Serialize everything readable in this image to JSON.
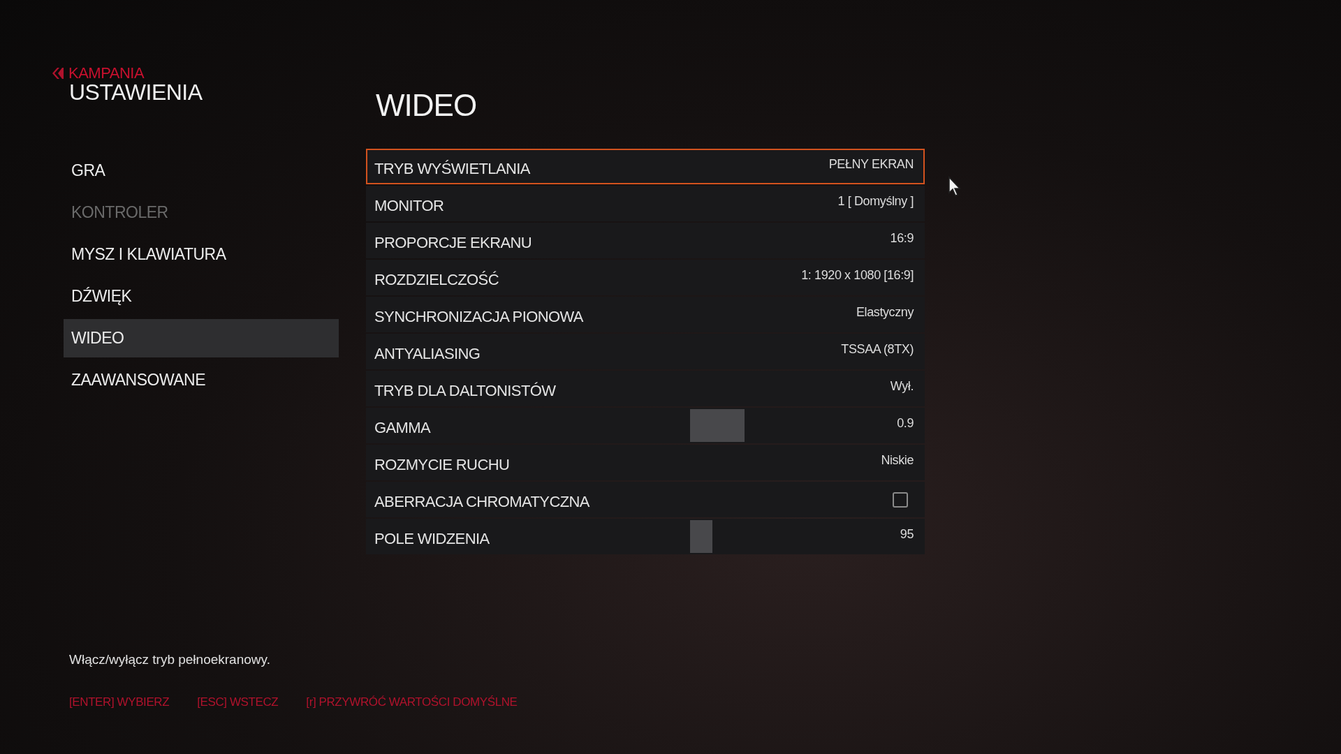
{
  "header": {
    "back": "KAMPANIA",
    "title": "USTAWIENIA"
  },
  "sidebar": {
    "items": [
      {
        "label": "GRA",
        "selected": false,
        "disabled": false
      },
      {
        "label": "KONTROLER",
        "selected": false,
        "disabled": true
      },
      {
        "label": "MYSZ I KLAWIATURA",
        "selected": false,
        "disabled": false
      },
      {
        "label": "DŹWIĘK",
        "selected": false,
        "disabled": false
      },
      {
        "label": "WIDEO",
        "selected": true,
        "disabled": false
      },
      {
        "label": "ZAAWANSOWANE",
        "selected": false,
        "disabled": false
      }
    ]
  },
  "section_title": "WIDEO",
  "settings": [
    {
      "kind": "value",
      "label": "TRYB WYŚWIETLANIA",
      "value": "PEŁNY EKRAN",
      "selected": true
    },
    {
      "kind": "value",
      "label": "MONITOR",
      "value": "1 [ Domyślny ]",
      "selected": false
    },
    {
      "kind": "value",
      "label": "PROPORCJE EKRANU",
      "value": "16:9",
      "selected": false
    },
    {
      "kind": "value",
      "label": "ROZDZIELCZOŚĆ",
      "value": "1: 1920 x 1080 [16:9]",
      "selected": false
    },
    {
      "kind": "value",
      "label": "SYNCHRONIZACJA PIONOWA",
      "value": "Elastyczny",
      "selected": false
    },
    {
      "kind": "value",
      "label": "ANTYALIASING",
      "value": "TSSAA (8TX)",
      "selected": false
    },
    {
      "kind": "value",
      "label": "TRYB DLA DALTONISTÓW",
      "value": "Wył.",
      "selected": false
    },
    {
      "kind": "slider",
      "label": "GAMMA",
      "value": "0.9",
      "level": 0.29,
      "selected": false
    },
    {
      "kind": "value",
      "label": "ROZMYCIE RUCHU",
      "value": "Niskie",
      "selected": false
    },
    {
      "kind": "checkbox",
      "label": "ABERRACJA CHROMATYCZNA",
      "checked": false,
      "selected": false
    },
    {
      "kind": "slider",
      "label": "POLE WIDZENIA",
      "value": "95",
      "level": 0.12,
      "selected": false
    }
  ],
  "hint": "Włącz/wyłącz tryb pełnoekranowy.",
  "footer": [
    "[ENTER] WYBIERZ",
    "[ESC] WSTECZ",
    "[r] PRZYWRÓĆ WARTOŚCI DOMYŚLNE"
  ]
}
